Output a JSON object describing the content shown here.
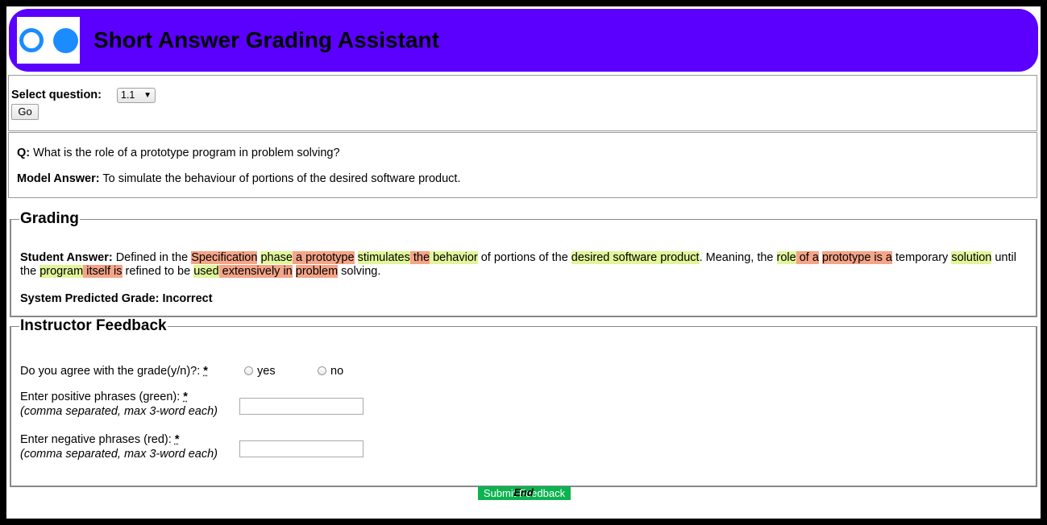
{
  "header": {
    "title": "Short Answer Grading Assistant"
  },
  "question_select": {
    "label": "Select question:",
    "value": "1.1",
    "go_label": "Go"
  },
  "question": {
    "q_label": "Q:",
    "q_text": " What is the role of a prototype program in problem solving?",
    "model_label": "Model Answer:",
    "model_text": " To simulate the behaviour of portions of the desired software product."
  },
  "grading": {
    "legend": "Grading",
    "student_label": "Student Answer:",
    "student_segments": [
      {
        "t": " Defined in the ",
        "c": ""
      },
      {
        "t": "Specification",
        "c": "r"
      },
      {
        "t": " ",
        "c": ""
      },
      {
        "t": "phase",
        "c": "g"
      },
      {
        "t": " a prototype",
        "c": "r"
      },
      {
        "t": " ",
        "c": ""
      },
      {
        "t": "stimulates",
        "c": "g"
      },
      {
        "t": " the",
        "c": "r"
      },
      {
        "t": " behavior",
        "c": "g"
      },
      {
        "t": " of portions of the ",
        "c": ""
      },
      {
        "t": "desired software product",
        "c": "g"
      },
      {
        "t": ". Meaning, the ",
        "c": ""
      },
      {
        "t": "role",
        "c": "g"
      },
      {
        "t": " of a",
        "c": "r"
      },
      {
        "t": " ",
        "c": ""
      },
      {
        "t": "prototype is a",
        "c": "r"
      },
      {
        "t": " temporary ",
        "c": ""
      },
      {
        "t": "solution",
        "c": "g"
      },
      {
        "t": " until the ",
        "c": ""
      },
      {
        "t": "program",
        "c": "g"
      },
      {
        "t": " itself is",
        "c": "r"
      },
      {
        "t": " refined to be ",
        "c": ""
      },
      {
        "t": "used",
        "c": "g"
      },
      {
        "t": " extensively in",
        "c": "r"
      },
      {
        "t": " ",
        "c": ""
      },
      {
        "t": "problem",
        "c": "r"
      },
      {
        "t": " solving.",
        "c": ""
      }
    ],
    "predicted": "System Predicted Grade: Incorrect"
  },
  "feedback": {
    "legend": "Instructor Feedback",
    "agree_label": "Do you agree with the grade(y/n)?: ",
    "required_mark": "*",
    "yes_label": "yes",
    "no_label": "no",
    "positive_label": "Enter positive phrases (green): ",
    "negative_label": "Enter negative phrases (red): ",
    "hint": "(comma separated, max 3-word each)",
    "submit_label": "Submit Feedback"
  },
  "footer": {
    "end_text": "End"
  },
  "colors": {
    "header_bg": "#5b00ff",
    "positive_highlight": "#e1f59a",
    "negative_highlight": "#f4a488",
    "submit_bg": "#0cb350"
  }
}
